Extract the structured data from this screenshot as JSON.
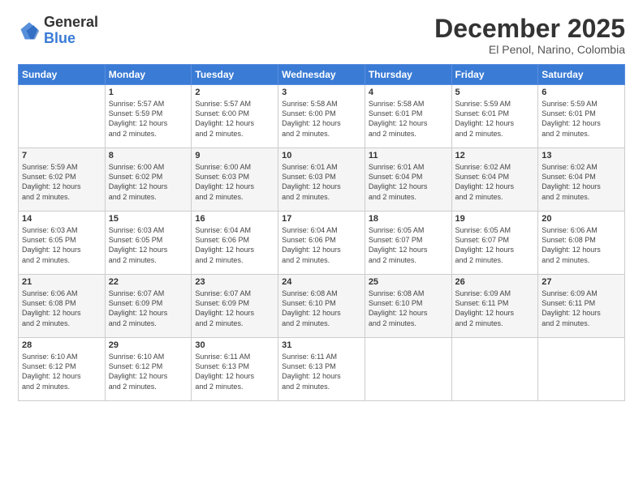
{
  "logo": {
    "line1": "General",
    "line2": "Blue"
  },
  "title": "December 2025",
  "subtitle": "El Penol, Narino, Colombia",
  "days_of_week": [
    "Sunday",
    "Monday",
    "Tuesday",
    "Wednesday",
    "Thursday",
    "Friday",
    "Saturday"
  ],
  "weeks": [
    [
      {
        "day": "",
        "info": ""
      },
      {
        "day": "1",
        "info": "Sunrise: 5:57 AM\nSunset: 5:59 PM\nDaylight: 12 hours\nand 2 minutes."
      },
      {
        "day": "2",
        "info": "Sunrise: 5:57 AM\nSunset: 6:00 PM\nDaylight: 12 hours\nand 2 minutes."
      },
      {
        "day": "3",
        "info": "Sunrise: 5:58 AM\nSunset: 6:00 PM\nDaylight: 12 hours\nand 2 minutes."
      },
      {
        "day": "4",
        "info": "Sunrise: 5:58 AM\nSunset: 6:01 PM\nDaylight: 12 hours\nand 2 minutes."
      },
      {
        "day": "5",
        "info": "Sunrise: 5:59 AM\nSunset: 6:01 PM\nDaylight: 12 hours\nand 2 minutes."
      },
      {
        "day": "6",
        "info": "Sunrise: 5:59 AM\nSunset: 6:01 PM\nDaylight: 12 hours\nand 2 minutes."
      }
    ],
    [
      {
        "day": "7",
        "info": "Sunrise: 5:59 AM\nSunset: 6:02 PM\nDaylight: 12 hours\nand 2 minutes."
      },
      {
        "day": "8",
        "info": "Sunrise: 6:00 AM\nSunset: 6:02 PM\nDaylight: 12 hours\nand 2 minutes."
      },
      {
        "day": "9",
        "info": "Sunrise: 6:00 AM\nSunset: 6:03 PM\nDaylight: 12 hours\nand 2 minutes."
      },
      {
        "day": "10",
        "info": "Sunrise: 6:01 AM\nSunset: 6:03 PM\nDaylight: 12 hours\nand 2 minutes."
      },
      {
        "day": "11",
        "info": "Sunrise: 6:01 AM\nSunset: 6:04 PM\nDaylight: 12 hours\nand 2 minutes."
      },
      {
        "day": "12",
        "info": "Sunrise: 6:02 AM\nSunset: 6:04 PM\nDaylight: 12 hours\nand 2 minutes."
      },
      {
        "day": "13",
        "info": "Sunrise: 6:02 AM\nSunset: 6:04 PM\nDaylight: 12 hours\nand 2 minutes."
      }
    ],
    [
      {
        "day": "14",
        "info": "Sunrise: 6:03 AM\nSunset: 6:05 PM\nDaylight: 12 hours\nand 2 minutes."
      },
      {
        "day": "15",
        "info": "Sunrise: 6:03 AM\nSunset: 6:05 PM\nDaylight: 12 hours\nand 2 minutes."
      },
      {
        "day": "16",
        "info": "Sunrise: 6:04 AM\nSunset: 6:06 PM\nDaylight: 12 hours\nand 2 minutes."
      },
      {
        "day": "17",
        "info": "Sunrise: 6:04 AM\nSunset: 6:06 PM\nDaylight: 12 hours\nand 2 minutes."
      },
      {
        "day": "18",
        "info": "Sunrise: 6:05 AM\nSunset: 6:07 PM\nDaylight: 12 hours\nand 2 minutes."
      },
      {
        "day": "19",
        "info": "Sunrise: 6:05 AM\nSunset: 6:07 PM\nDaylight: 12 hours\nand 2 minutes."
      },
      {
        "day": "20",
        "info": "Sunrise: 6:06 AM\nSunset: 6:08 PM\nDaylight: 12 hours\nand 2 minutes."
      }
    ],
    [
      {
        "day": "21",
        "info": "Sunrise: 6:06 AM\nSunset: 6:08 PM\nDaylight: 12 hours\nand 2 minutes."
      },
      {
        "day": "22",
        "info": "Sunrise: 6:07 AM\nSunset: 6:09 PM\nDaylight: 12 hours\nand 2 minutes."
      },
      {
        "day": "23",
        "info": "Sunrise: 6:07 AM\nSunset: 6:09 PM\nDaylight: 12 hours\nand 2 minutes."
      },
      {
        "day": "24",
        "info": "Sunrise: 6:08 AM\nSunset: 6:10 PM\nDaylight: 12 hours\nand 2 minutes."
      },
      {
        "day": "25",
        "info": "Sunrise: 6:08 AM\nSunset: 6:10 PM\nDaylight: 12 hours\nand 2 minutes."
      },
      {
        "day": "26",
        "info": "Sunrise: 6:09 AM\nSunset: 6:11 PM\nDaylight: 12 hours\nand 2 minutes."
      },
      {
        "day": "27",
        "info": "Sunrise: 6:09 AM\nSunset: 6:11 PM\nDaylight: 12 hours\nand 2 minutes."
      }
    ],
    [
      {
        "day": "28",
        "info": "Sunrise: 6:10 AM\nSunset: 6:12 PM\nDaylight: 12 hours\nand 2 minutes."
      },
      {
        "day": "29",
        "info": "Sunrise: 6:10 AM\nSunset: 6:12 PM\nDaylight: 12 hours\nand 2 minutes."
      },
      {
        "day": "30",
        "info": "Sunrise: 6:11 AM\nSunset: 6:13 PM\nDaylight: 12 hours\nand 2 minutes."
      },
      {
        "day": "31",
        "info": "Sunrise: 6:11 AM\nSunset: 6:13 PM\nDaylight: 12 hours\nand 2 minutes."
      },
      {
        "day": "",
        "info": ""
      },
      {
        "day": "",
        "info": ""
      },
      {
        "day": "",
        "info": ""
      }
    ]
  ]
}
